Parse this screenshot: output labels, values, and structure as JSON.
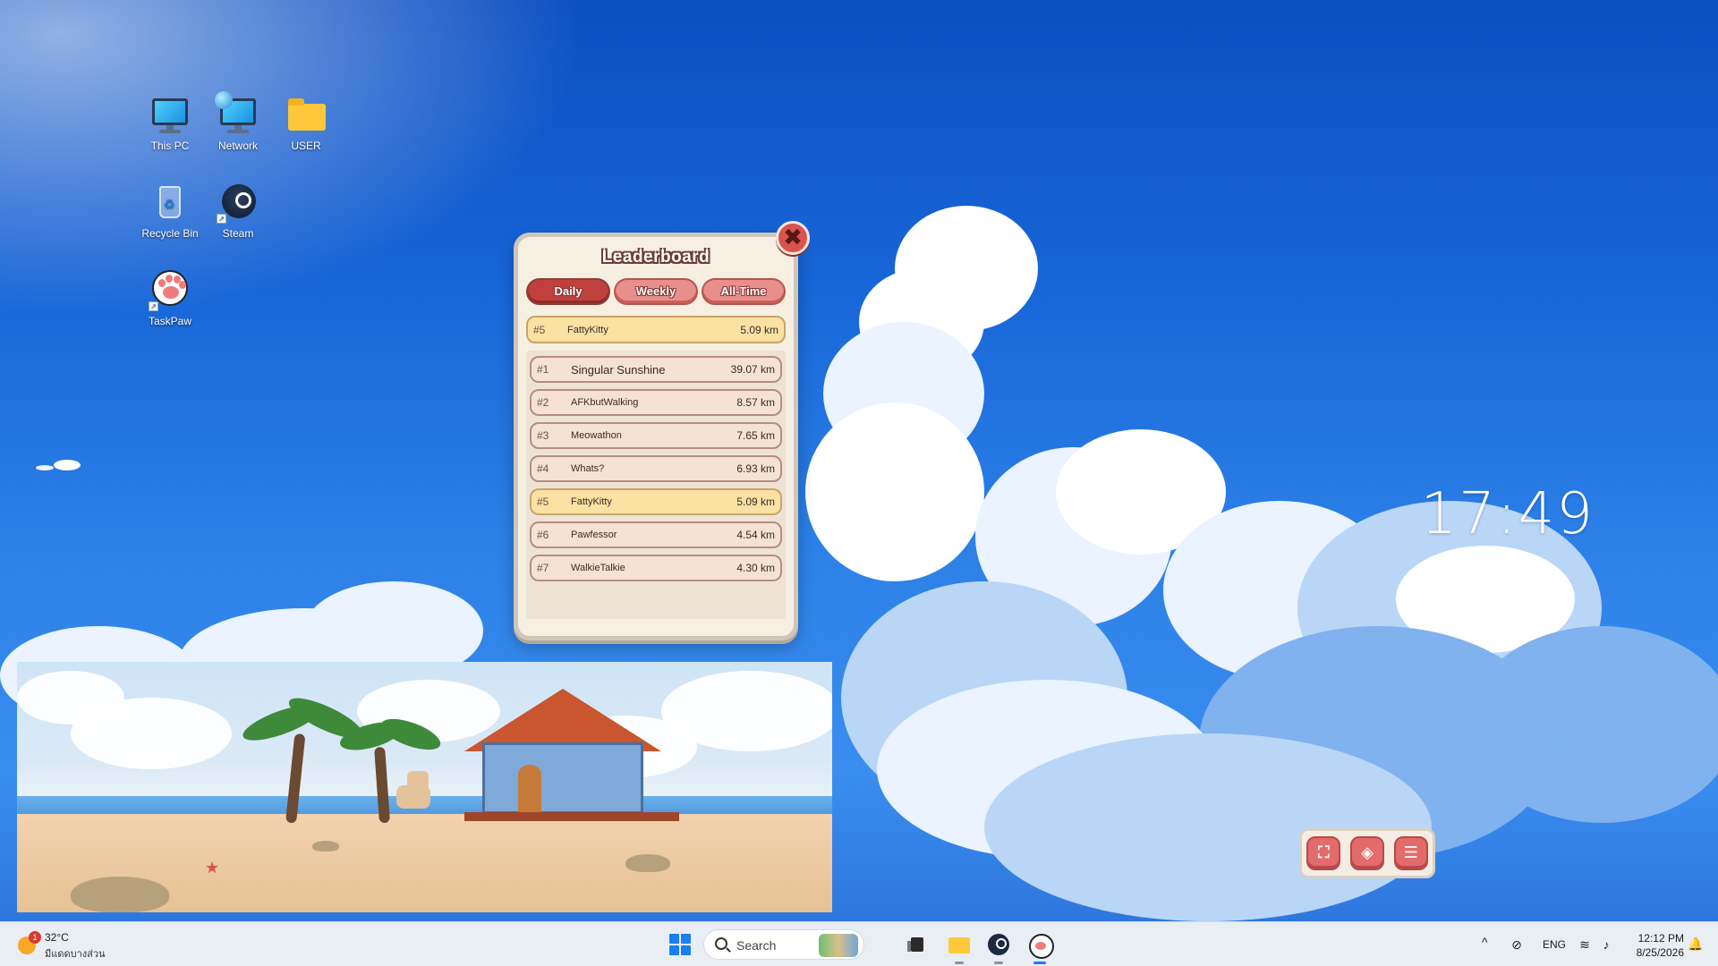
{
  "desktop": {
    "icons": [
      {
        "label": "This PC",
        "icon": "monitor-icon"
      },
      {
        "label": "Network",
        "icon": "network-icon"
      },
      {
        "label": "USER",
        "icon": "folder-icon"
      },
      {
        "label": "Recycle Bin",
        "icon": "recycle-bin-icon"
      },
      {
        "label": "Steam",
        "icon": "steam-icon"
      },
      {
        "label": "TaskPaw",
        "icon": "paw-icon"
      }
    ],
    "clock": "17:49"
  },
  "leaderboard": {
    "title": "Leaderboard",
    "close_symbol": "✖",
    "tabs": [
      {
        "label": "Daily",
        "active": true
      },
      {
        "label": "Weekly",
        "active": false
      },
      {
        "label": "All-Time",
        "active": false
      }
    ],
    "current_user": {
      "rank": "#5",
      "name": "FattyKitty",
      "distance": "5.09 km"
    },
    "entries": [
      {
        "rank": "#1",
        "name": "Singular Sunshine",
        "distance": "39.07 km"
      },
      {
        "rank": "#2",
        "name": "AFKbutWalking",
        "distance": "8.57 km"
      },
      {
        "rank": "#3",
        "name": "Meowathon",
        "distance": "7.65 km"
      },
      {
        "rank": "#4",
        "name": "Whats?",
        "distance": "6.93 km"
      },
      {
        "rank": "#5",
        "name": "FattyKitty",
        "distance": "5.09 km"
      },
      {
        "rank": "#6",
        "name": "Pawfessor",
        "distance": "4.54 km"
      },
      {
        "rank": "#7",
        "name": "WalkieTalkie",
        "distance": "4.30 km"
      }
    ],
    "colors": {
      "accent": "#c0403d",
      "highlight_row": "#fbe2a3",
      "row": "#f6e1d5"
    }
  },
  "game_controls": {
    "buttons": [
      {
        "icon": "fullscreen-icon",
        "glyph": "⛶"
      },
      {
        "icon": "layers-icon",
        "glyph": "◈"
      },
      {
        "icon": "menu-icon",
        "glyph": "☰"
      }
    ]
  },
  "taskbar": {
    "weather": {
      "badge": "1",
      "temp": "32°C",
      "desc": "มีแดดบางส่วน"
    },
    "search_placeholder": "Search",
    "tray": {
      "chevron": "^",
      "language": "ENG",
      "time": "12:12 PM",
      "date": "8/25/2026"
    }
  }
}
